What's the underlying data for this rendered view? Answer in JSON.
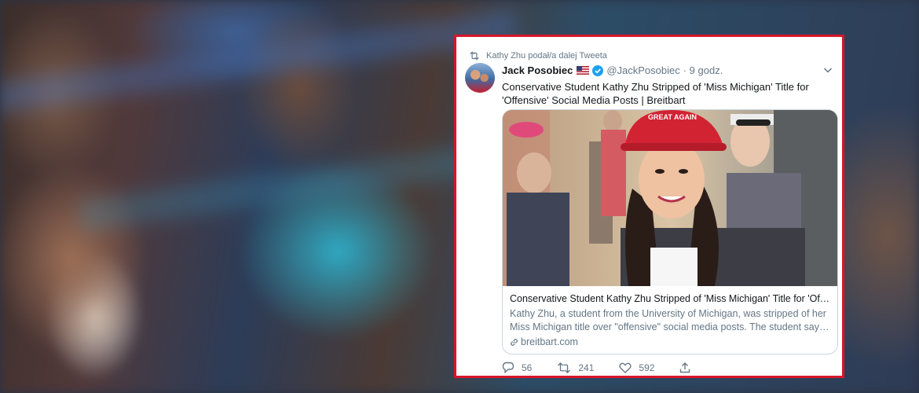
{
  "tweet": {
    "retweeted_by": "Kathy Zhu podał/a dalej Tweeta",
    "author_name": "Jack Posobiec",
    "handle": "@JackPosobiec",
    "time": "· 9 godz.",
    "text": "Conservative Student Kathy Zhu Stripped of 'Miss Michigan' Title for 'Offensive' Social Media Posts | Breitbart",
    "card": {
      "hat_text": "GREAT AGAIN",
      "title": "Conservative Student Kathy Zhu Stripped of 'Miss Michigan' Title for 'Offensive' Social Media Posts",
      "description": "Kathy Zhu, a student from the University of Michigan, was stripped of her Miss Michigan title over \"offensive\" social media posts. The student says ...",
      "domain": "breitbart.com"
    },
    "actions": {
      "replies": "56",
      "retweets": "241",
      "likes": "592"
    }
  },
  "icons": {
    "retweet": "retweet-icon",
    "verified": "verified-badge-icon",
    "flag": "us-flag-icon",
    "chevron": "chevron-down-icon",
    "link": "link-icon",
    "reply": "reply-icon",
    "like": "heart-icon",
    "share": "share-icon"
  },
  "colors": {
    "frame_border": "#d8162a",
    "verified_blue": "#1da1f2",
    "secondary_text": "#657786"
  }
}
